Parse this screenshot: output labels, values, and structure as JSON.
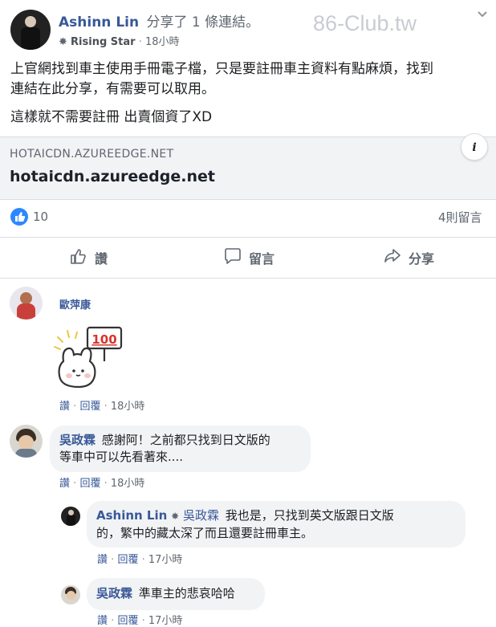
{
  "watermark": "86-Club.tw",
  "post": {
    "author": "Ashinn Lin",
    "action": "分享了 1 條連結。",
    "badge": "Rising Star",
    "sep": "·",
    "time": "18小時",
    "text_line1": "上官網找到車主使用手冊電子檔，只是要註冊車主資料有點麻煩，找到",
    "text_line2": "連結在此分享，有需要可以取用。",
    "text_line3": "這樣就不需要註冊 出賣個資了XD",
    "link_domain_caps": "HOTAICDN.AZUREEDGE.NET",
    "link_title": "hotaicdn.azureedge.net",
    "info_glyph": "i",
    "like_count": "10",
    "comment_count": "4則留言"
  },
  "actions": {
    "like": "讚",
    "comment": "留言",
    "share": "分享"
  },
  "comments": [
    {
      "author": "歐萍康",
      "sticker_text": "100",
      "like": "讚",
      "reply": "回覆",
      "sep": "·",
      "time": "18小時"
    },
    {
      "author": "吳政霖",
      "text_line1": "感謝阿！之前都只找到日文版的",
      "text_line2": "等車中可以先看著來....",
      "like": "讚",
      "reply": "回覆",
      "sep": "·",
      "time": "18小時"
    }
  ],
  "replies": [
    {
      "author": "Ashinn Lin",
      "mention": "吳政霖",
      "text_line1": "我也是，只找到英文版跟日文版",
      "text_line2": "的，繁中的藏太深了而且還要註冊車主。",
      "like": "讚",
      "reply": "回覆",
      "sep": "·",
      "time": "17小時"
    },
    {
      "author": "吳政霖",
      "text": "準車主的悲哀哈哈",
      "like": "讚",
      "reply": "回覆",
      "sep": "·",
      "time": "17小時"
    }
  ]
}
